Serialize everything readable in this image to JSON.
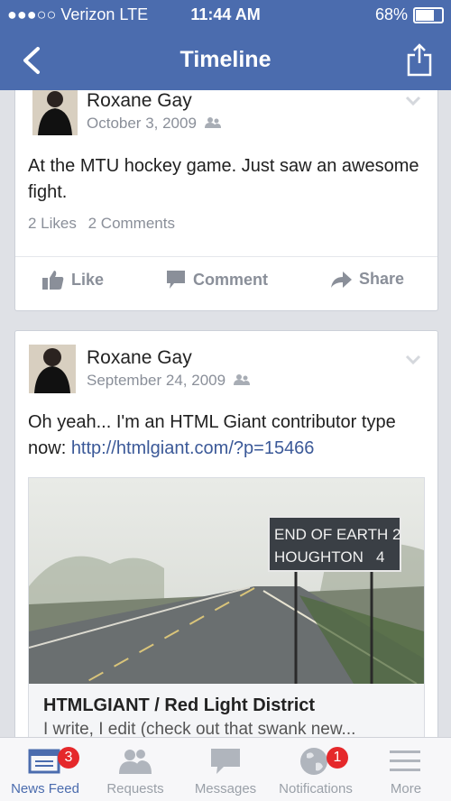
{
  "status_bar": {
    "carrier": "●●●○○ Verizon  LTE",
    "time": "11:44 AM",
    "battery_pct": "68%"
  },
  "nav": {
    "title": "Timeline"
  },
  "posts": [
    {
      "author": "Roxane Gay",
      "date": "October 3, 2009",
      "text": "At the MTU hockey game. Just saw an awesome fight.",
      "likes": "2 Likes",
      "comments": "2 Comments",
      "actions": {
        "like": "Like",
        "comment": "Comment",
        "share": "Share"
      }
    },
    {
      "author": "Roxane Gay",
      "date": "September 24, 2009",
      "text_prefix": "Oh yeah... I'm an HTML Giant contributor type now: ",
      "link_url": "http://htmlgiant.com/?p=15466",
      "link_preview": {
        "sign_line1": "END OF EARTH 2",
        "sign_line2": "HOUGHTON   4",
        "title": "HTMLGIANT / Red Light District",
        "description": "I write, I edit (check out that swank new..."
      }
    }
  ],
  "tabbar": {
    "items": [
      {
        "label": "News Feed",
        "badge": "3",
        "icon": "news-feed-icon",
        "active": true
      },
      {
        "label": "Requests",
        "icon": "requests-icon"
      },
      {
        "label": "Messages",
        "icon": "messages-icon"
      },
      {
        "label": "Notifications",
        "badge": "1",
        "icon": "globe-icon"
      },
      {
        "label": "More",
        "icon": "menu-icon"
      }
    ]
  },
  "colors": {
    "brand": "#4b6cae",
    "badge": "#e5282b",
    "link": "#3b5998"
  }
}
